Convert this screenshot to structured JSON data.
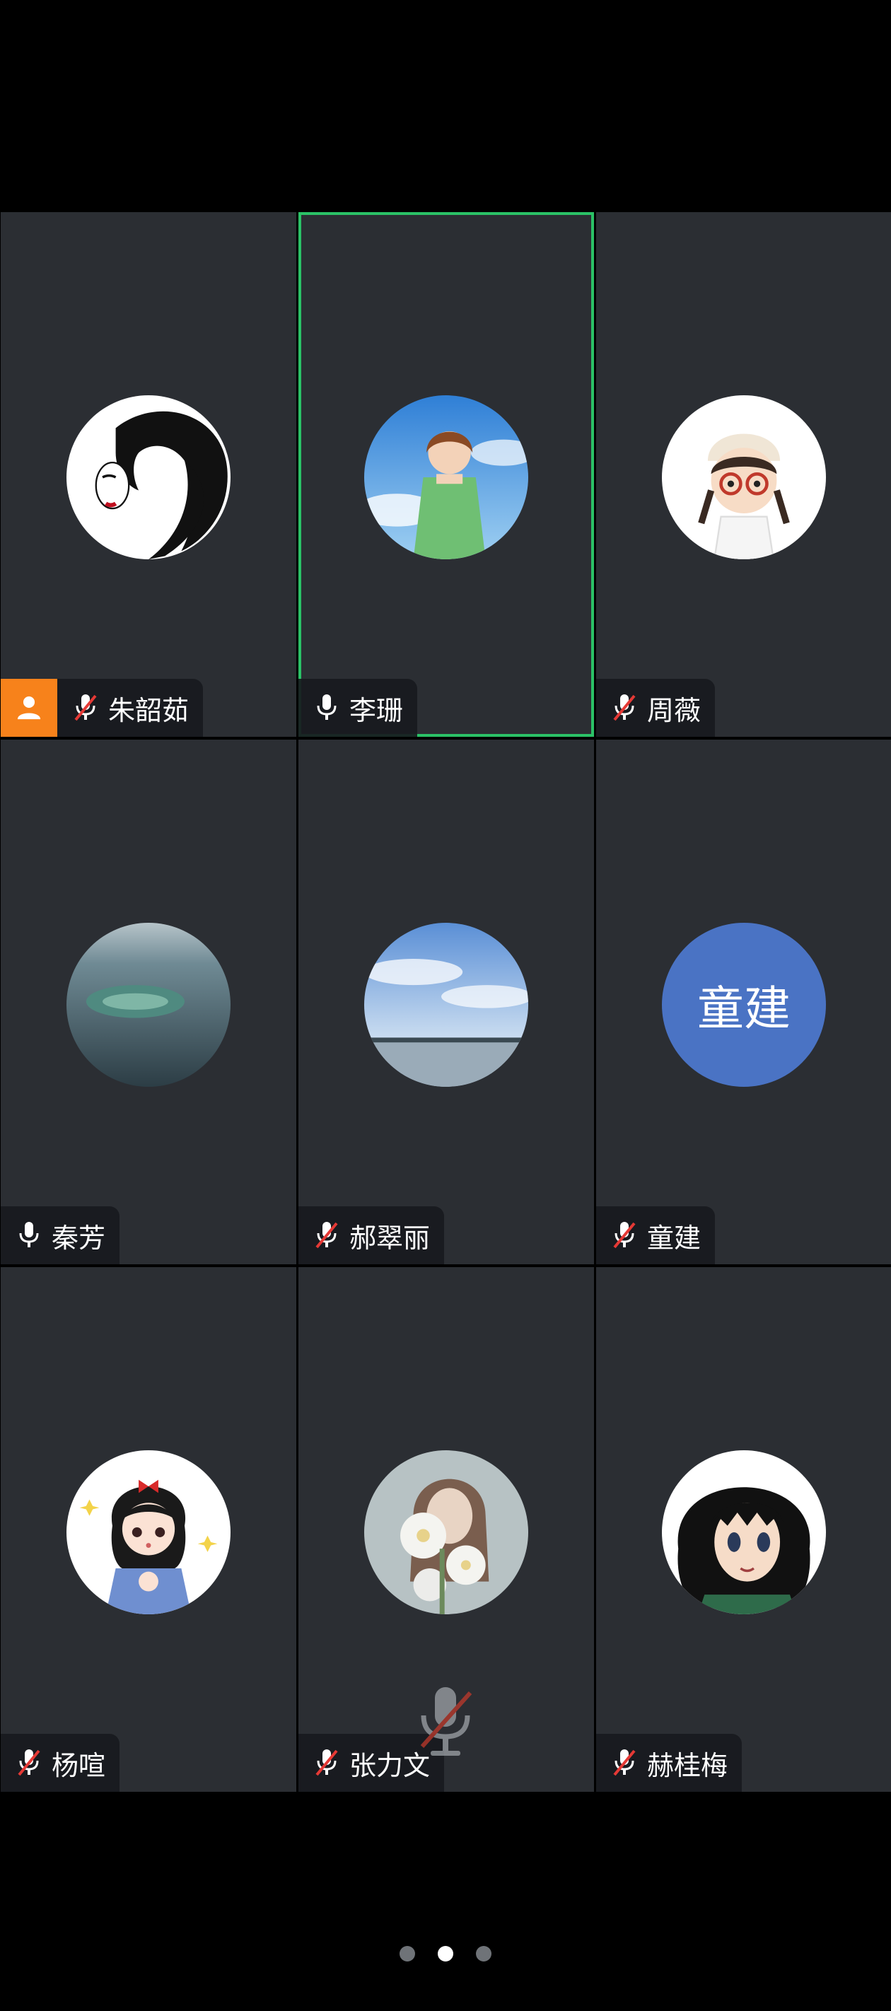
{
  "participants": [
    {
      "name": "朱韶茹",
      "mic": "muted",
      "host": true,
      "active": false,
      "avatar_icon": "avatar-black-hair-woman-icon"
    },
    {
      "name": "李珊",
      "mic": "on",
      "host": false,
      "active": true,
      "avatar_icon": "avatar-anime-girl-sky-icon"
    },
    {
      "name": "周薇",
      "mic": "muted",
      "host": false,
      "active": false,
      "avatar_icon": "avatar-girl-glasses-icon"
    },
    {
      "name": "秦芳",
      "mic": "on",
      "host": false,
      "active": false,
      "avatar_icon": "avatar-ocean-island-icon"
    },
    {
      "name": "郝翠丽",
      "mic": "muted",
      "host": false,
      "active": false,
      "avatar_icon": "avatar-sky-lake-icon"
    },
    {
      "name": "童建",
      "mic": "muted",
      "host": false,
      "active": false,
      "avatar_text": "童建",
      "avatar_color": "#4a73c4"
    },
    {
      "name": "杨喧",
      "mic": "muted",
      "host": false,
      "active": false,
      "avatar_icon": "avatar-cartoon-princess-icon"
    },
    {
      "name": "张力文",
      "mic": "muted",
      "host": false,
      "active": false,
      "avatar_icon": "avatar-flowers-woman-icon"
    },
    {
      "name": "赫桂梅",
      "mic": "muted",
      "host": false,
      "active": false,
      "avatar_icon": "avatar-anime-boy-icon"
    }
  ],
  "colors": {
    "tile_bg": "#2b2e33",
    "active_border": "#2bc267",
    "host_badge": "#f7821b",
    "muted_slash": "#e53935",
    "text_avatar_bg": "#4a73c4"
  },
  "pager": {
    "pages": 3,
    "current": 2
  }
}
